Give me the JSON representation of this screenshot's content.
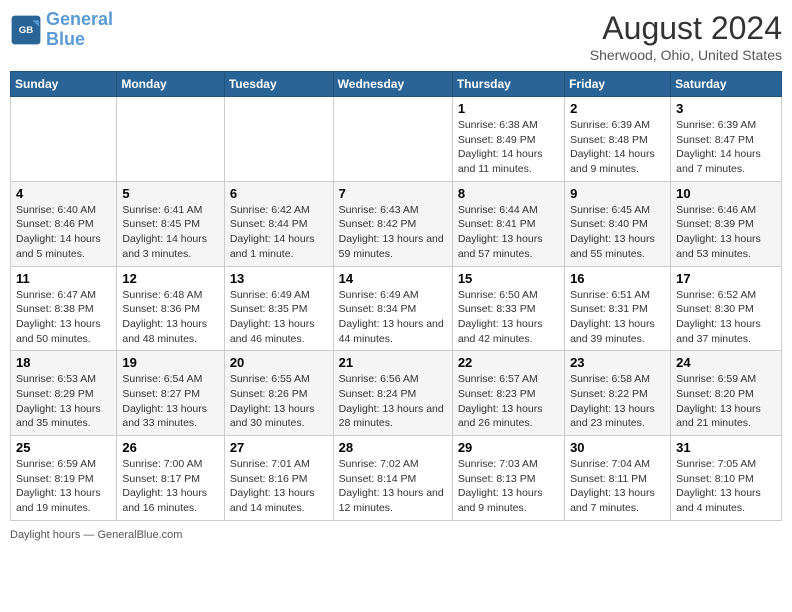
{
  "header": {
    "logo_line1": "General",
    "logo_line2": "Blue",
    "title": "August 2024",
    "subtitle": "Sherwood, Ohio, United States"
  },
  "days_of_week": [
    "Sunday",
    "Monday",
    "Tuesday",
    "Wednesday",
    "Thursday",
    "Friday",
    "Saturday"
  ],
  "weeks": [
    [
      {
        "day": "",
        "info": ""
      },
      {
        "day": "",
        "info": ""
      },
      {
        "day": "",
        "info": ""
      },
      {
        "day": "",
        "info": ""
      },
      {
        "day": "1",
        "info": "Sunrise: 6:38 AM\nSunset: 8:49 PM\nDaylight: 14 hours and 11 minutes."
      },
      {
        "day": "2",
        "info": "Sunrise: 6:39 AM\nSunset: 8:48 PM\nDaylight: 14 hours and 9 minutes."
      },
      {
        "day": "3",
        "info": "Sunrise: 6:39 AM\nSunset: 8:47 PM\nDaylight: 14 hours and 7 minutes."
      }
    ],
    [
      {
        "day": "4",
        "info": "Sunrise: 6:40 AM\nSunset: 8:46 PM\nDaylight: 14 hours and 5 minutes."
      },
      {
        "day": "5",
        "info": "Sunrise: 6:41 AM\nSunset: 8:45 PM\nDaylight: 14 hours and 3 minutes."
      },
      {
        "day": "6",
        "info": "Sunrise: 6:42 AM\nSunset: 8:44 PM\nDaylight: 14 hours and 1 minute."
      },
      {
        "day": "7",
        "info": "Sunrise: 6:43 AM\nSunset: 8:42 PM\nDaylight: 13 hours and 59 minutes."
      },
      {
        "day": "8",
        "info": "Sunrise: 6:44 AM\nSunset: 8:41 PM\nDaylight: 13 hours and 57 minutes."
      },
      {
        "day": "9",
        "info": "Sunrise: 6:45 AM\nSunset: 8:40 PM\nDaylight: 13 hours and 55 minutes."
      },
      {
        "day": "10",
        "info": "Sunrise: 6:46 AM\nSunset: 8:39 PM\nDaylight: 13 hours and 53 minutes."
      }
    ],
    [
      {
        "day": "11",
        "info": "Sunrise: 6:47 AM\nSunset: 8:38 PM\nDaylight: 13 hours and 50 minutes."
      },
      {
        "day": "12",
        "info": "Sunrise: 6:48 AM\nSunset: 8:36 PM\nDaylight: 13 hours and 48 minutes."
      },
      {
        "day": "13",
        "info": "Sunrise: 6:49 AM\nSunset: 8:35 PM\nDaylight: 13 hours and 46 minutes."
      },
      {
        "day": "14",
        "info": "Sunrise: 6:49 AM\nSunset: 8:34 PM\nDaylight: 13 hours and 44 minutes."
      },
      {
        "day": "15",
        "info": "Sunrise: 6:50 AM\nSunset: 8:33 PM\nDaylight: 13 hours and 42 minutes."
      },
      {
        "day": "16",
        "info": "Sunrise: 6:51 AM\nSunset: 8:31 PM\nDaylight: 13 hours and 39 minutes."
      },
      {
        "day": "17",
        "info": "Sunrise: 6:52 AM\nSunset: 8:30 PM\nDaylight: 13 hours and 37 minutes."
      }
    ],
    [
      {
        "day": "18",
        "info": "Sunrise: 6:53 AM\nSunset: 8:29 PM\nDaylight: 13 hours and 35 minutes."
      },
      {
        "day": "19",
        "info": "Sunrise: 6:54 AM\nSunset: 8:27 PM\nDaylight: 13 hours and 33 minutes."
      },
      {
        "day": "20",
        "info": "Sunrise: 6:55 AM\nSunset: 8:26 PM\nDaylight: 13 hours and 30 minutes."
      },
      {
        "day": "21",
        "info": "Sunrise: 6:56 AM\nSunset: 8:24 PM\nDaylight: 13 hours and 28 minutes."
      },
      {
        "day": "22",
        "info": "Sunrise: 6:57 AM\nSunset: 8:23 PM\nDaylight: 13 hours and 26 minutes."
      },
      {
        "day": "23",
        "info": "Sunrise: 6:58 AM\nSunset: 8:22 PM\nDaylight: 13 hours and 23 minutes."
      },
      {
        "day": "24",
        "info": "Sunrise: 6:59 AM\nSunset: 8:20 PM\nDaylight: 13 hours and 21 minutes."
      }
    ],
    [
      {
        "day": "25",
        "info": "Sunrise: 6:59 AM\nSunset: 8:19 PM\nDaylight: 13 hours and 19 minutes."
      },
      {
        "day": "26",
        "info": "Sunrise: 7:00 AM\nSunset: 8:17 PM\nDaylight: 13 hours and 16 minutes."
      },
      {
        "day": "27",
        "info": "Sunrise: 7:01 AM\nSunset: 8:16 PM\nDaylight: 13 hours and 14 minutes."
      },
      {
        "day": "28",
        "info": "Sunrise: 7:02 AM\nSunset: 8:14 PM\nDaylight: 13 hours and 12 minutes."
      },
      {
        "day": "29",
        "info": "Sunrise: 7:03 AM\nSunset: 8:13 PM\nDaylight: 13 hours and 9 minutes."
      },
      {
        "day": "30",
        "info": "Sunrise: 7:04 AM\nSunset: 8:11 PM\nDaylight: 13 hours and 7 minutes."
      },
      {
        "day": "31",
        "info": "Sunrise: 7:05 AM\nSunset: 8:10 PM\nDaylight: 13 hours and 4 minutes."
      }
    ]
  ],
  "footer": {
    "label": "Daylight hours",
    "source": "GeneralBlue.com"
  }
}
